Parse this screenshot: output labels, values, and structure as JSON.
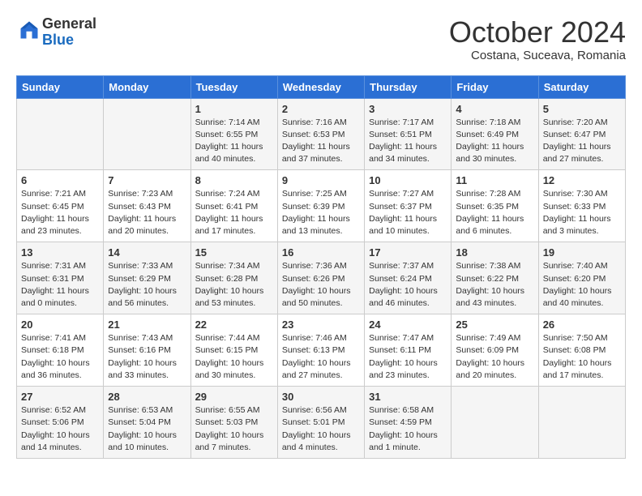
{
  "header": {
    "logo_line1": "General",
    "logo_line2": "Blue",
    "month": "October 2024",
    "location": "Costana, Suceava, Romania"
  },
  "days_of_week": [
    "Sunday",
    "Monday",
    "Tuesday",
    "Wednesday",
    "Thursday",
    "Friday",
    "Saturday"
  ],
  "weeks": [
    [
      {
        "day": "",
        "info": ""
      },
      {
        "day": "",
        "info": ""
      },
      {
        "day": "1",
        "info": "Sunrise: 7:14 AM\nSunset: 6:55 PM\nDaylight: 11 hours and 40 minutes."
      },
      {
        "day": "2",
        "info": "Sunrise: 7:16 AM\nSunset: 6:53 PM\nDaylight: 11 hours and 37 minutes."
      },
      {
        "day": "3",
        "info": "Sunrise: 7:17 AM\nSunset: 6:51 PM\nDaylight: 11 hours and 34 minutes."
      },
      {
        "day": "4",
        "info": "Sunrise: 7:18 AM\nSunset: 6:49 PM\nDaylight: 11 hours and 30 minutes."
      },
      {
        "day": "5",
        "info": "Sunrise: 7:20 AM\nSunset: 6:47 PM\nDaylight: 11 hours and 27 minutes."
      }
    ],
    [
      {
        "day": "6",
        "info": "Sunrise: 7:21 AM\nSunset: 6:45 PM\nDaylight: 11 hours and 23 minutes."
      },
      {
        "day": "7",
        "info": "Sunrise: 7:23 AM\nSunset: 6:43 PM\nDaylight: 11 hours and 20 minutes."
      },
      {
        "day": "8",
        "info": "Sunrise: 7:24 AM\nSunset: 6:41 PM\nDaylight: 11 hours and 17 minutes."
      },
      {
        "day": "9",
        "info": "Sunrise: 7:25 AM\nSunset: 6:39 PM\nDaylight: 11 hours and 13 minutes."
      },
      {
        "day": "10",
        "info": "Sunrise: 7:27 AM\nSunset: 6:37 PM\nDaylight: 11 hours and 10 minutes."
      },
      {
        "day": "11",
        "info": "Sunrise: 7:28 AM\nSunset: 6:35 PM\nDaylight: 11 hours and 6 minutes."
      },
      {
        "day": "12",
        "info": "Sunrise: 7:30 AM\nSunset: 6:33 PM\nDaylight: 11 hours and 3 minutes."
      }
    ],
    [
      {
        "day": "13",
        "info": "Sunrise: 7:31 AM\nSunset: 6:31 PM\nDaylight: 11 hours and 0 minutes."
      },
      {
        "day": "14",
        "info": "Sunrise: 7:33 AM\nSunset: 6:29 PM\nDaylight: 10 hours and 56 minutes."
      },
      {
        "day": "15",
        "info": "Sunrise: 7:34 AM\nSunset: 6:28 PM\nDaylight: 10 hours and 53 minutes."
      },
      {
        "day": "16",
        "info": "Sunrise: 7:36 AM\nSunset: 6:26 PM\nDaylight: 10 hours and 50 minutes."
      },
      {
        "day": "17",
        "info": "Sunrise: 7:37 AM\nSunset: 6:24 PM\nDaylight: 10 hours and 46 minutes."
      },
      {
        "day": "18",
        "info": "Sunrise: 7:38 AM\nSunset: 6:22 PM\nDaylight: 10 hours and 43 minutes."
      },
      {
        "day": "19",
        "info": "Sunrise: 7:40 AM\nSunset: 6:20 PM\nDaylight: 10 hours and 40 minutes."
      }
    ],
    [
      {
        "day": "20",
        "info": "Sunrise: 7:41 AM\nSunset: 6:18 PM\nDaylight: 10 hours and 36 minutes."
      },
      {
        "day": "21",
        "info": "Sunrise: 7:43 AM\nSunset: 6:16 PM\nDaylight: 10 hours and 33 minutes."
      },
      {
        "day": "22",
        "info": "Sunrise: 7:44 AM\nSunset: 6:15 PM\nDaylight: 10 hours and 30 minutes."
      },
      {
        "day": "23",
        "info": "Sunrise: 7:46 AM\nSunset: 6:13 PM\nDaylight: 10 hours and 27 minutes."
      },
      {
        "day": "24",
        "info": "Sunrise: 7:47 AM\nSunset: 6:11 PM\nDaylight: 10 hours and 23 minutes."
      },
      {
        "day": "25",
        "info": "Sunrise: 7:49 AM\nSunset: 6:09 PM\nDaylight: 10 hours and 20 minutes."
      },
      {
        "day": "26",
        "info": "Sunrise: 7:50 AM\nSunset: 6:08 PM\nDaylight: 10 hours and 17 minutes."
      }
    ],
    [
      {
        "day": "27",
        "info": "Sunrise: 6:52 AM\nSunset: 5:06 PM\nDaylight: 10 hours and 14 minutes."
      },
      {
        "day": "28",
        "info": "Sunrise: 6:53 AM\nSunset: 5:04 PM\nDaylight: 10 hours and 10 minutes."
      },
      {
        "day": "29",
        "info": "Sunrise: 6:55 AM\nSunset: 5:03 PM\nDaylight: 10 hours and 7 minutes."
      },
      {
        "day": "30",
        "info": "Sunrise: 6:56 AM\nSunset: 5:01 PM\nDaylight: 10 hours and 4 minutes."
      },
      {
        "day": "31",
        "info": "Sunrise: 6:58 AM\nSunset: 4:59 PM\nDaylight: 10 hours and 1 minute."
      },
      {
        "day": "",
        "info": ""
      },
      {
        "day": "",
        "info": ""
      }
    ]
  ]
}
